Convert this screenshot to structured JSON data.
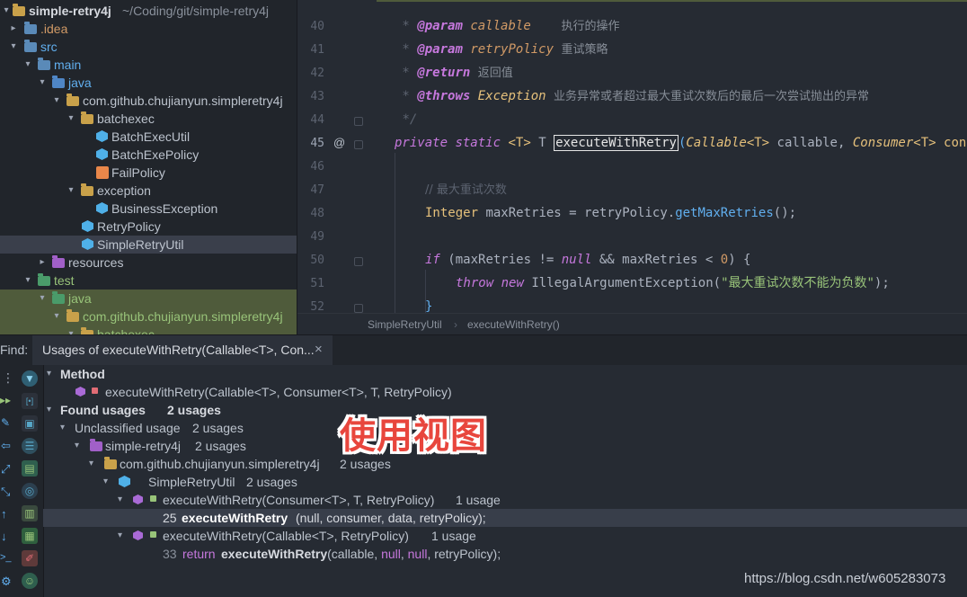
{
  "project_tree": {
    "root": {
      "name": "simple-retry4j",
      "path": "~/Coding/git/simple-retry4j"
    },
    "items": [
      {
        "label": ".idea"
      },
      {
        "label": "src"
      },
      {
        "label": "main"
      },
      {
        "label": "java"
      },
      {
        "label": "com.github.chujianyun.simpleretry4j"
      },
      {
        "label": "batchexec"
      },
      {
        "label": "BatchExecUtil"
      },
      {
        "label": "BatchExePolicy"
      },
      {
        "label": "FailPolicy"
      },
      {
        "label": "exception"
      },
      {
        "label": "BusinessException"
      },
      {
        "label": "RetryPolicy"
      },
      {
        "label": "SimpleRetryUtil"
      },
      {
        "label": "resources"
      },
      {
        "label": "test"
      },
      {
        "label": "java"
      },
      {
        "label": "com.github.chujianyun.simpleretry4j"
      },
      {
        "label": "batchexec"
      }
    ]
  },
  "editor": {
    "line_numbers": [
      "40",
      "41",
      "42",
      "43",
      "44",
      "45",
      "46",
      "47",
      "48",
      "49",
      "50",
      "51",
      "52"
    ],
    "lines": {
      "l40": {
        "tag": "@param",
        "name": "callable",
        "desc": "执行的操作"
      },
      "l41": {
        "tag": "@param",
        "name": "retryPolicy",
        "desc": "重试策略"
      },
      "l42": {
        "tag": "@return",
        "desc": "返回值"
      },
      "l43": {
        "tag": "@throws",
        "name": "Exception",
        "desc": "业务异常或者超过最大重试次数后的最后一次尝试抛出的异常"
      },
      "l44": {
        "text": "*/"
      },
      "l45": {
        "kw1": "private",
        "kw2": "static",
        "generic": "<T>",
        "ret": "T",
        "method": "executeWithRetry",
        "p1type": "Callable",
        "p1gen": "<T>",
        "p1name": "callable,",
        "p2type": "Consumer",
        "p2gen": "<T>",
        "p2name": "con"
      },
      "l47": {
        "comment": "// 最大重试次数"
      },
      "l48": {
        "type": "Integer",
        "var": "maxRetries",
        "rhs_obj": "retryPolicy.",
        "rhs_fn": "getMaxRetries",
        "rhs_end": "();"
      },
      "l50": {
        "kw": "if",
        "cond_a": "(maxRetries != ",
        "null": "null",
        "cond_b": " && maxRetries < ",
        "zero": "0",
        "end": ") {"
      },
      "l51": {
        "kw1": "throw",
        "kw2": "new",
        "cls": "IllegalArgumentException",
        "str": "\"最大重试次数不能为负数\"",
        "end": ");"
      },
      "l52": {
        "text": "}"
      }
    },
    "breadcrumb": [
      "SimpleRetryUtil",
      "executeWithRetry()"
    ]
  },
  "find": {
    "label": "Find:",
    "tab_title": "Usages of executeWithRetry(Callable<T>, Con...",
    "close": "×",
    "results": {
      "method_header": "Method",
      "method_sig": "executeWithRetry(Callable<T>, Consumer<T>, T, RetryPolicy)",
      "found_usages": "Found usages",
      "found_count": "2 usages",
      "unclassified": "Unclassified usage",
      "unclassified_count": "2 usages",
      "module": "simple-retry4j",
      "module_count": "2 usages",
      "package": "com.github.chujianyun.simpleretry4j",
      "package_count": "2 usages",
      "class": "SimpleRetryUtil",
      "class_count": "2 usages",
      "usage1_sig": "executeWithRetry(Consumer<T>, T, RetryPolicy)",
      "usage1_count": "1 usage",
      "usage1_line": "25",
      "usage1_call": "executeWithRetry",
      "usage1_args": "(null, consumer, data, retryPolicy);",
      "usage2_sig": "executeWithRetry(Callable<T>, RetryPolicy)",
      "usage2_count": "1 usage",
      "usage2_line": "33",
      "usage2_return": "return",
      "usage2_call": "executeWithRetry",
      "usage2_open": "(callable, ",
      "usage2_null1": "null",
      "usage2_sep": ", ",
      "usage2_null2": "null",
      "usage2_close": ", retryPolicy);"
    }
  },
  "overlay": {
    "text": "使用视图"
  },
  "watermark": {
    "text": "https://blog.csdn.net/w605283073"
  }
}
